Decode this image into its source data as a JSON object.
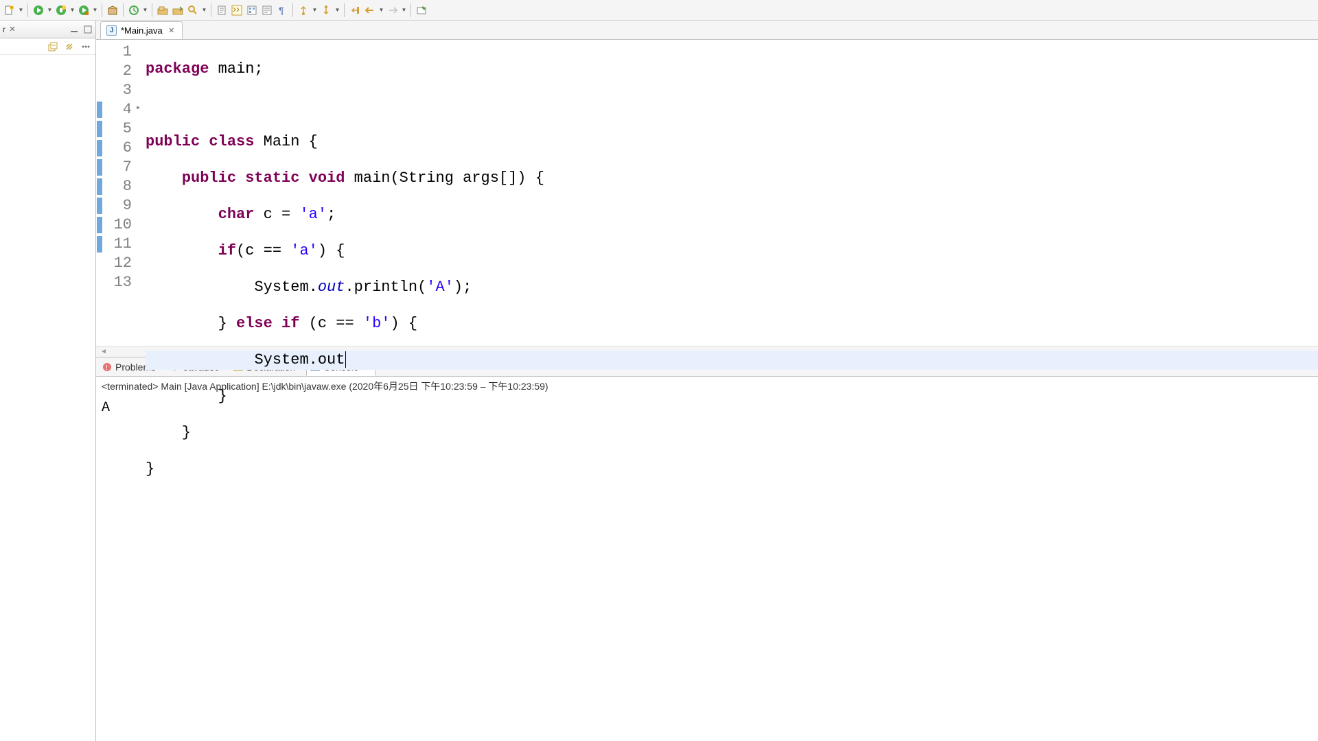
{
  "tab": {
    "filename": "*Main.java"
  },
  "editor": {
    "lineNumbers": [
      "1",
      "2",
      "3",
      "4",
      "5",
      "6",
      "7",
      "8",
      "9",
      "10",
      "11",
      "12",
      "13"
    ],
    "highlightedLine": 9,
    "lines": {
      "l1_kw": "package",
      "l1_rest": " main;",
      "l3_kw1": "public",
      "l3_kw2": "class",
      "l3_rest": " Main {",
      "l4_indent": "    ",
      "l4_kw1": "public",
      "l4_kw2": "static",
      "l4_kw3": "void",
      "l4_rest": " main(String args[]) {",
      "l5_indent": "        ",
      "l5_kw": "char",
      "l5_mid": " c = ",
      "l5_str": "'a'",
      "l5_end": ";",
      "l6_indent": "        ",
      "l6_kw": "if",
      "l6_mid": "(c == ",
      "l6_str": "'a'",
      "l6_end": ") {",
      "l7_indent": "            ",
      "l7_sys": "System.",
      "l7_out": "out",
      "l7_mid": ".println(",
      "l7_str": "'A'",
      "l7_end": ");",
      "l8_indent": "        ",
      "l8_brace": "} ",
      "l8_kw1": "else",
      "l8_sp": " ",
      "l8_kw2": "if",
      "l8_mid": " (c == ",
      "l8_str": "'b'",
      "l8_end": ") {",
      "l9_indent": "            ",
      "l9_sys": "System.out",
      "l10": "        }",
      "l11": "    }",
      "l12": "}"
    }
  },
  "bottomTabs": {
    "problems": "Problems",
    "javadoc": "Javadoc",
    "declaration": "Declaration",
    "console": "Console"
  },
  "console": {
    "header": "<terminated> Main [Java Application] E:\\jdk\\bin\\javaw.exe  (2020年6月25日 下午10:23:59 – 下午10:23:59)",
    "output": "A"
  }
}
